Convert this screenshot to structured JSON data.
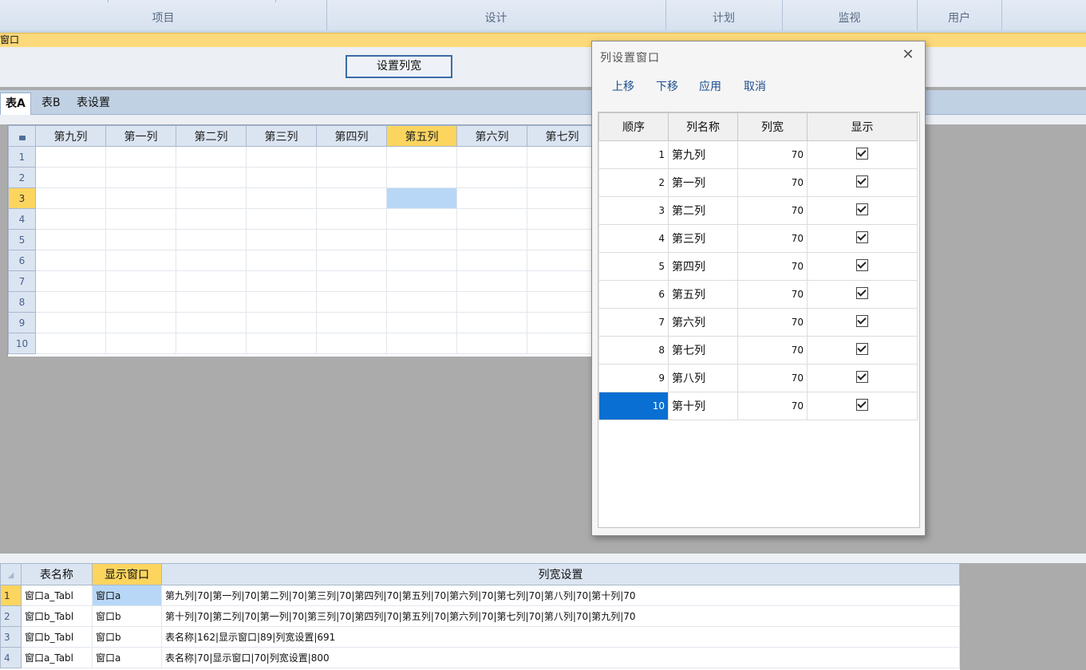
{
  "ribbon": {
    "groups": [
      "项目",
      "设计",
      "计划",
      "监视",
      "用户"
    ]
  },
  "window_title": "窗口",
  "toolbar": {
    "set_width_label": "设置列宽"
  },
  "tabs": [
    "表A",
    "表B",
    "表设置"
  ],
  "main_grid": {
    "corner_icon": "lock-icon",
    "columns": [
      "第九列",
      "第一列",
      "第二列",
      "第三列",
      "第四列",
      "第五列",
      "第六列",
      "第七列"
    ],
    "selected_column": "第五列",
    "rows": [
      "1",
      "2",
      "3",
      "4",
      "5",
      "6",
      "7",
      "8",
      "9",
      "10"
    ],
    "selected_row": "3"
  },
  "dialog": {
    "title": "列设置窗口",
    "menu": {
      "up": "上移",
      "down": "下移",
      "apply": "应用",
      "cancel": "取消"
    },
    "headers": {
      "order": "顺序",
      "name": "列名称",
      "width": "列宽",
      "show": "显示"
    },
    "rows": [
      {
        "order": "1",
        "name": "第九列",
        "width": "70",
        "show": true
      },
      {
        "order": "2",
        "name": "第一列",
        "width": "70",
        "show": true
      },
      {
        "order": "3",
        "name": "第二列",
        "width": "70",
        "show": true
      },
      {
        "order": "4",
        "name": "第三列",
        "width": "70",
        "show": true
      },
      {
        "order": "5",
        "name": "第四列",
        "width": "70",
        "show": true
      },
      {
        "order": "6",
        "name": "第五列",
        "width": "70",
        "show": true
      },
      {
        "order": "7",
        "name": "第六列",
        "width": "70",
        "show": true
      },
      {
        "order": "8",
        "name": "第七列",
        "width": "70",
        "show": true
      },
      {
        "order": "9",
        "name": "第八列",
        "width": "70",
        "show": true
      },
      {
        "order": "10",
        "name": "第十列",
        "width": "70",
        "show": true
      }
    ],
    "selected_order": "10"
  },
  "bottom_grid": {
    "headers": {
      "table_name": "表名称",
      "window": "显示窗口",
      "settings": "列宽设置"
    },
    "rows": [
      {
        "num": "1",
        "table_name": "窗口a_Tabl",
        "window": "窗口a",
        "settings": "第九列|70|第一列|70|第二列|70|第三列|70|第四列|70|第五列|70|第六列|70|第七列|70|第八列|70|第十列|70"
      },
      {
        "num": "2",
        "table_name": "窗口b_Tabl",
        "window": "窗口b",
        "settings": "第十列|70|第二列|70|第一列|70|第三列|70|第四列|70|第五列|70|第六列|70|第七列|70|第八列|70|第九列|70"
      },
      {
        "num": "3",
        "table_name": "窗口b_Tabl",
        "window": "窗口b",
        "settings": "表名称|162|显示窗口|89|列宽设置|691"
      },
      {
        "num": "4",
        "table_name": "窗口a_Tabl",
        "window": "窗口a",
        "settings": "表名称|70|显示窗口|70|列宽设置|800"
      }
    ]
  }
}
